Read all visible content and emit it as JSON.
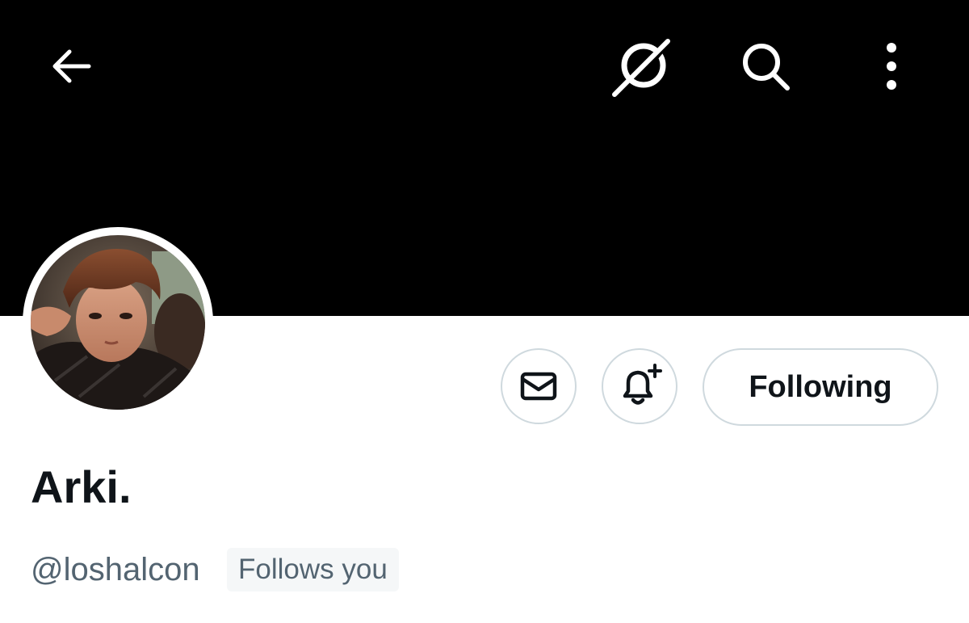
{
  "header": {
    "back_icon": "arrow-left-icon",
    "grok_icon": "grok-icon",
    "search_icon": "search-icon",
    "more_icon": "more-vertical-icon",
    "banner_color": "#000000"
  },
  "profile": {
    "display_name": "Arki.",
    "handle": "@loshalcon",
    "follows_you_label": "Follows you",
    "avatar": "profile-photo"
  },
  "actions": {
    "message_icon": "envelope-icon",
    "notify_icon": "bell-plus-icon",
    "following_label": "Following"
  },
  "colors": {
    "text_primary": "#0f1419",
    "text_secondary": "#536471",
    "border": "#cfd9de"
  }
}
